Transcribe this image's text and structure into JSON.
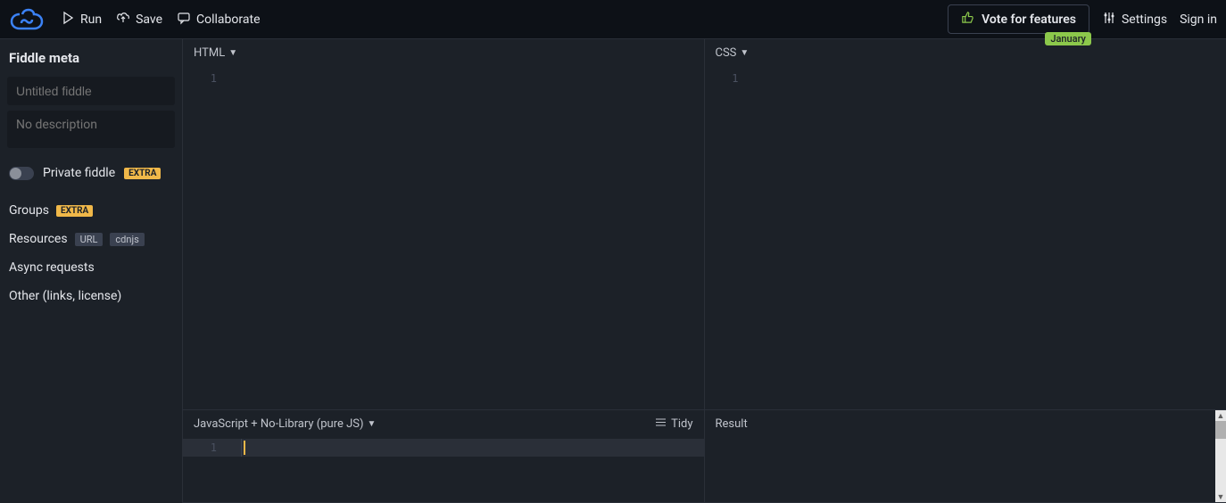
{
  "topbar": {
    "run": "Run",
    "save": "Save",
    "collaborate": "Collaborate",
    "vote": "Vote for features",
    "vote_badge": "January",
    "settings": "Settings",
    "signin": "Sign in"
  },
  "sidebar": {
    "meta_title": "Fiddle meta",
    "title_placeholder": "Untitled fiddle",
    "desc_placeholder": "No description",
    "private_label": "Private fiddle",
    "extra_badge": "EXTRA",
    "groups": "Groups",
    "resources": "Resources",
    "url_badge": "URL",
    "cdnjs_badge": "cdnjs",
    "async": "Async requests",
    "other": "Other (links, license)"
  },
  "panes": {
    "html": {
      "label": "HTML",
      "line": "1"
    },
    "css": {
      "label": "CSS",
      "line": "1"
    },
    "js": {
      "label": "JavaScript + No-Library (pure JS)",
      "line": "1",
      "tidy": "Tidy"
    },
    "result": {
      "label": "Result"
    }
  }
}
